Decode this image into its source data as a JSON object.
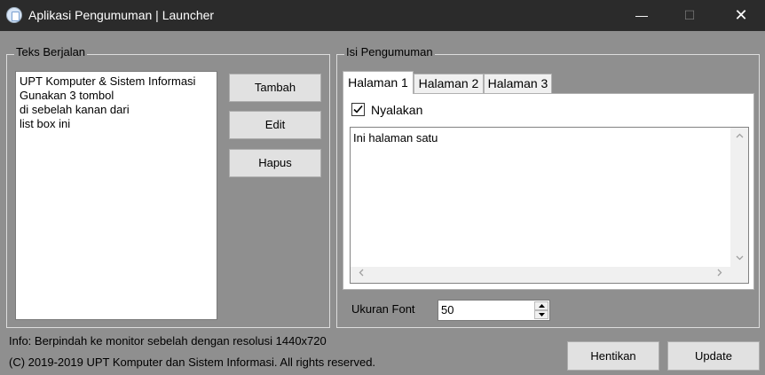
{
  "window": {
    "title": "Aplikasi Pengumuman | Launcher",
    "minimize": "—",
    "maximize": "☐",
    "close": "✕"
  },
  "teks_berjalan": {
    "label": "Teks Berjalan",
    "items": [
      "UPT Komputer & Sistem Informasi",
      "Gunakan 3 tombol",
      "di sebelah kanan dari",
      "list box ini"
    ],
    "buttons": {
      "tambah": "Tambah",
      "edit": "Edit",
      "hapus": "Hapus"
    }
  },
  "isi_pengumuman": {
    "label": "Isi Pengumuman",
    "tabs": [
      {
        "label": "Halaman 1",
        "active": true
      },
      {
        "label": "Halaman 2",
        "active": false
      },
      {
        "label": "Halaman 3",
        "active": false
      }
    ],
    "checkbox_label": "Nyalakan",
    "checkbox_checked": true,
    "text": "Ini halaman satu"
  },
  "font": {
    "label": "Ukuran Font",
    "value": "50"
  },
  "footer": {
    "info": "Info: Berpindah ke monitor sebelah dengan resolusi 1440x720",
    "copyright": "(C) 2019-2019 UPT Komputer dan Sistem Informasi. All rights reserved.",
    "hentikan": "Hentikan",
    "update": "Update"
  },
  "icons": {
    "app": "app-icon",
    "check": "check-icon",
    "scroll_up": "chevron-up-icon",
    "scroll_down": "chevron-down-icon",
    "scroll_left": "chevron-left-icon",
    "scroll_right": "chevron-right-icon"
  },
  "colors": {
    "titlebar": "#2b2b2b",
    "window_background": "#8f8f8f",
    "button": "#e1e1e1"
  }
}
